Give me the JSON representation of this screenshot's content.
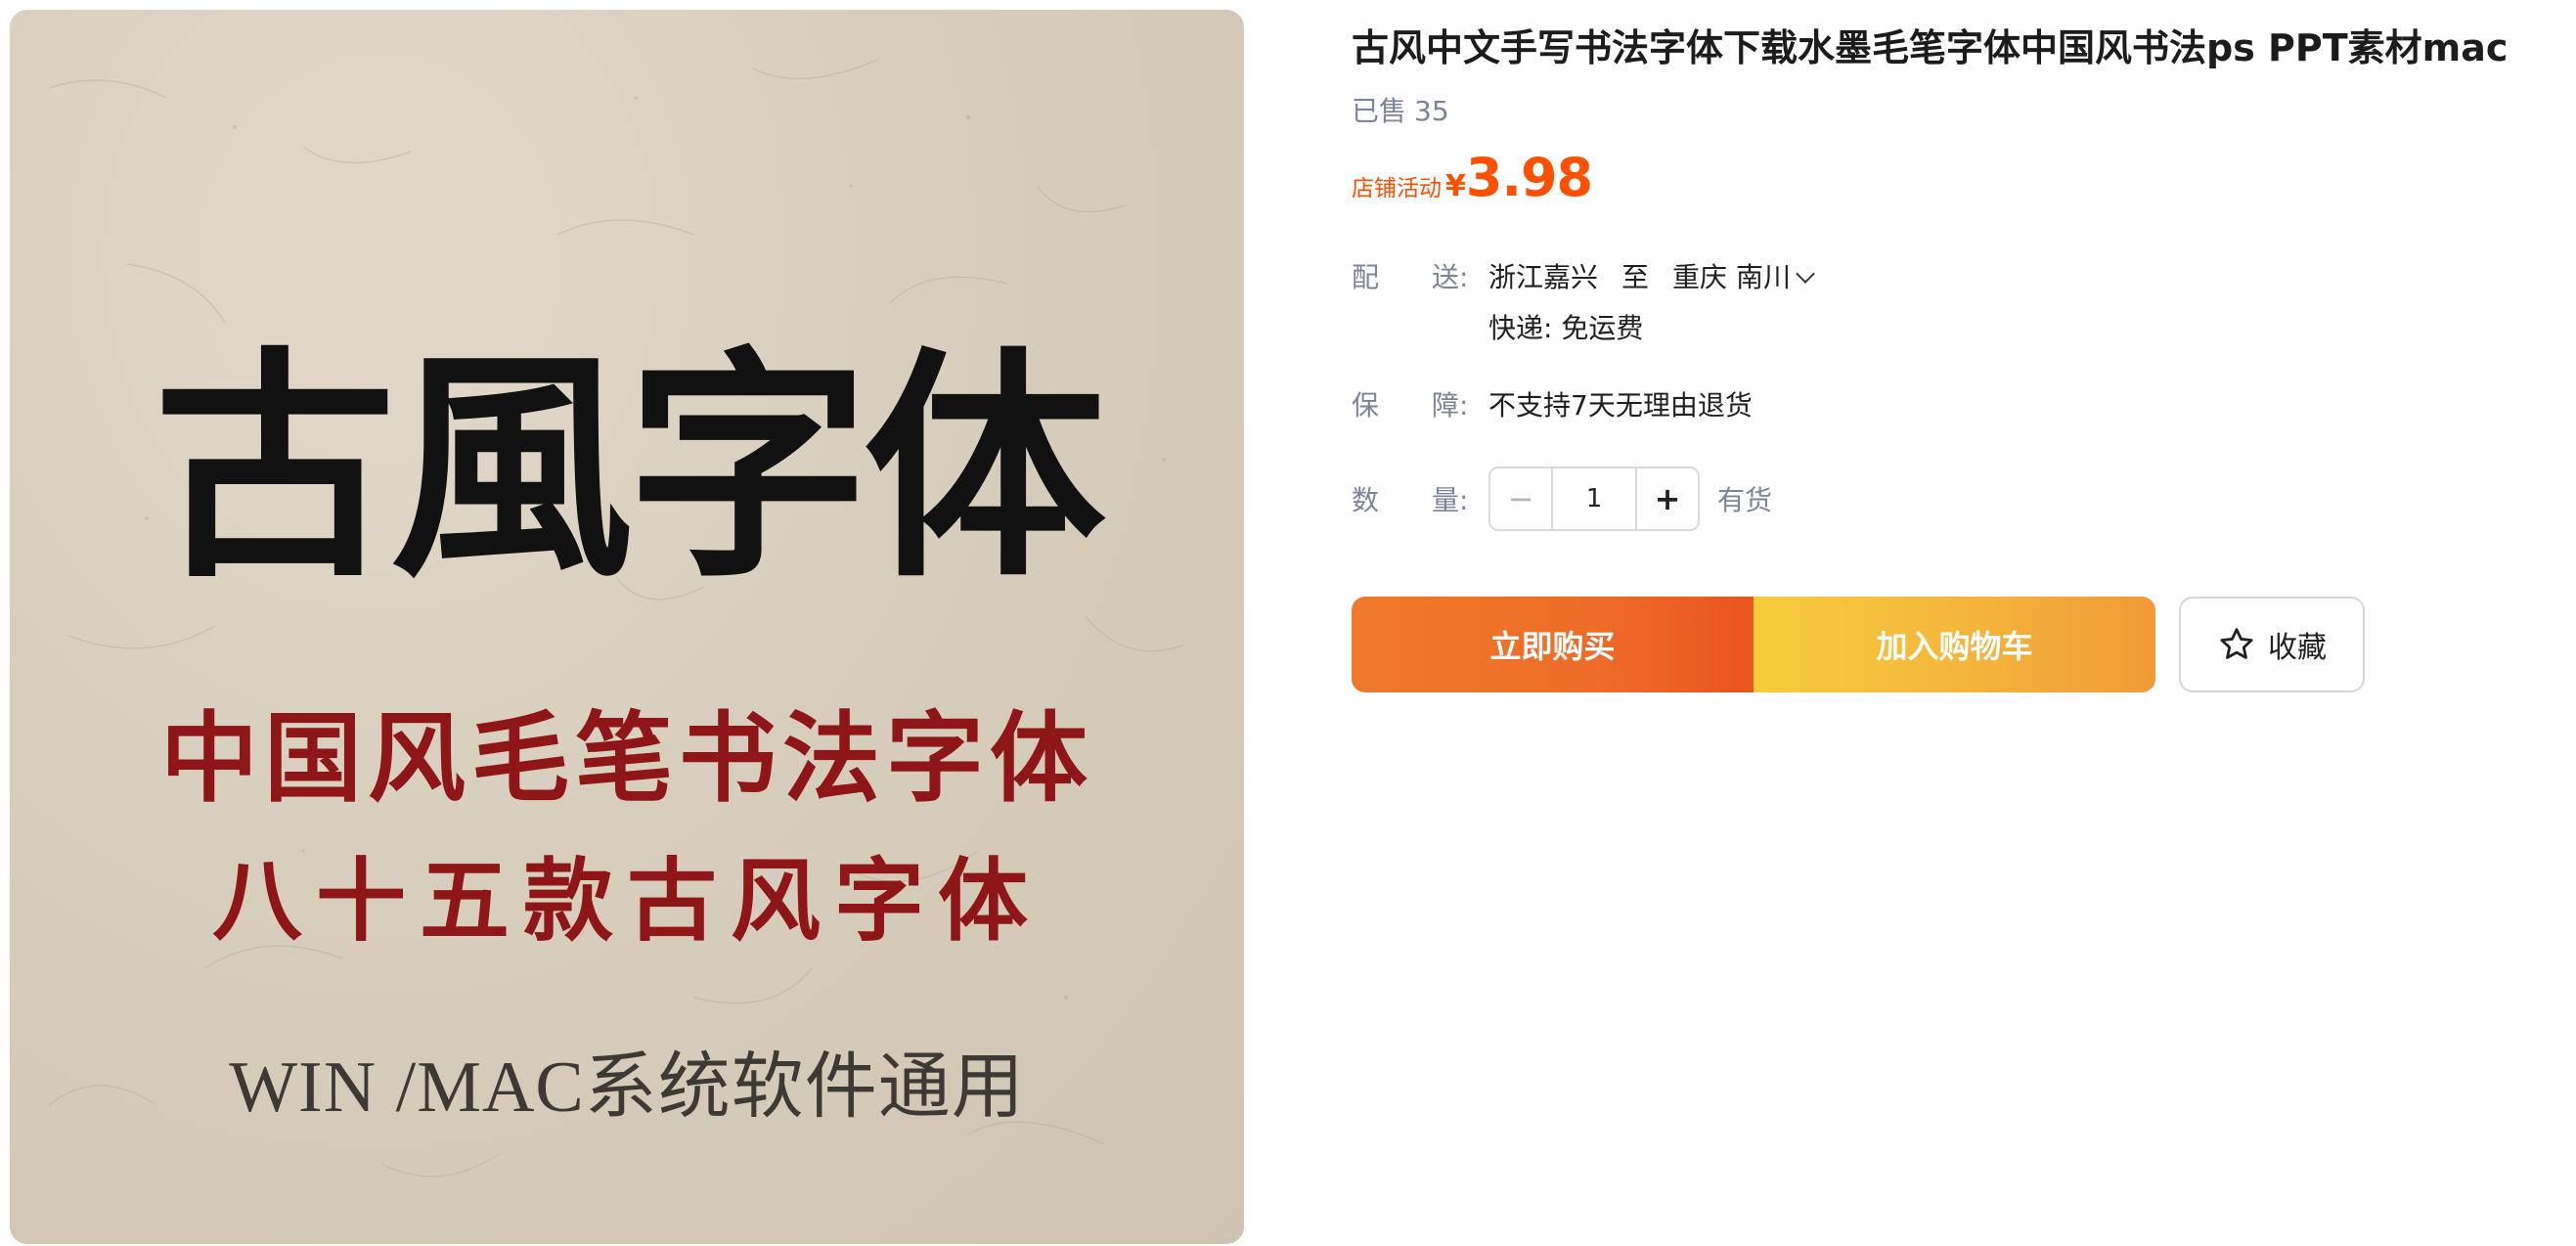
{
  "image": {
    "title": "古風字体",
    "subtitle_1": "中国风毛笔书法字体",
    "subtitle_2": "八十五款古风字体",
    "footer": "WIN /MAC系统软件通用"
  },
  "product": {
    "title": "古风中文手写书法字体下载水墨毛笔字体中国风书法ps PPT素材mac",
    "sold_label": "已售",
    "sold_count": "35",
    "promo_label": "店铺活动",
    "currency": "¥",
    "price": "3.98"
  },
  "delivery": {
    "label_a": "配",
    "label_b": "送:",
    "from": "浙江嘉兴",
    "to_word": "至",
    "dest_city": "重庆",
    "dest_district": "南川",
    "shipping": "快递: 免运费"
  },
  "guarantee": {
    "label_a": "保",
    "label_b": "障:",
    "value": "不支持7天无理由退货"
  },
  "quantity": {
    "label_a": "数",
    "label_b": "量:",
    "minus": "−",
    "value": "1",
    "plus": "+",
    "stock": "有货"
  },
  "actions": {
    "buy_now": "立即购买",
    "add_cart": "加入购物车",
    "favorite": "收藏",
    "favorite_icon": "star-icon"
  },
  "colors": {
    "accent": "#ff5000",
    "buy_gradient_start": "#f07a2a",
    "cart_gradient_start": "#f7cc3c"
  }
}
